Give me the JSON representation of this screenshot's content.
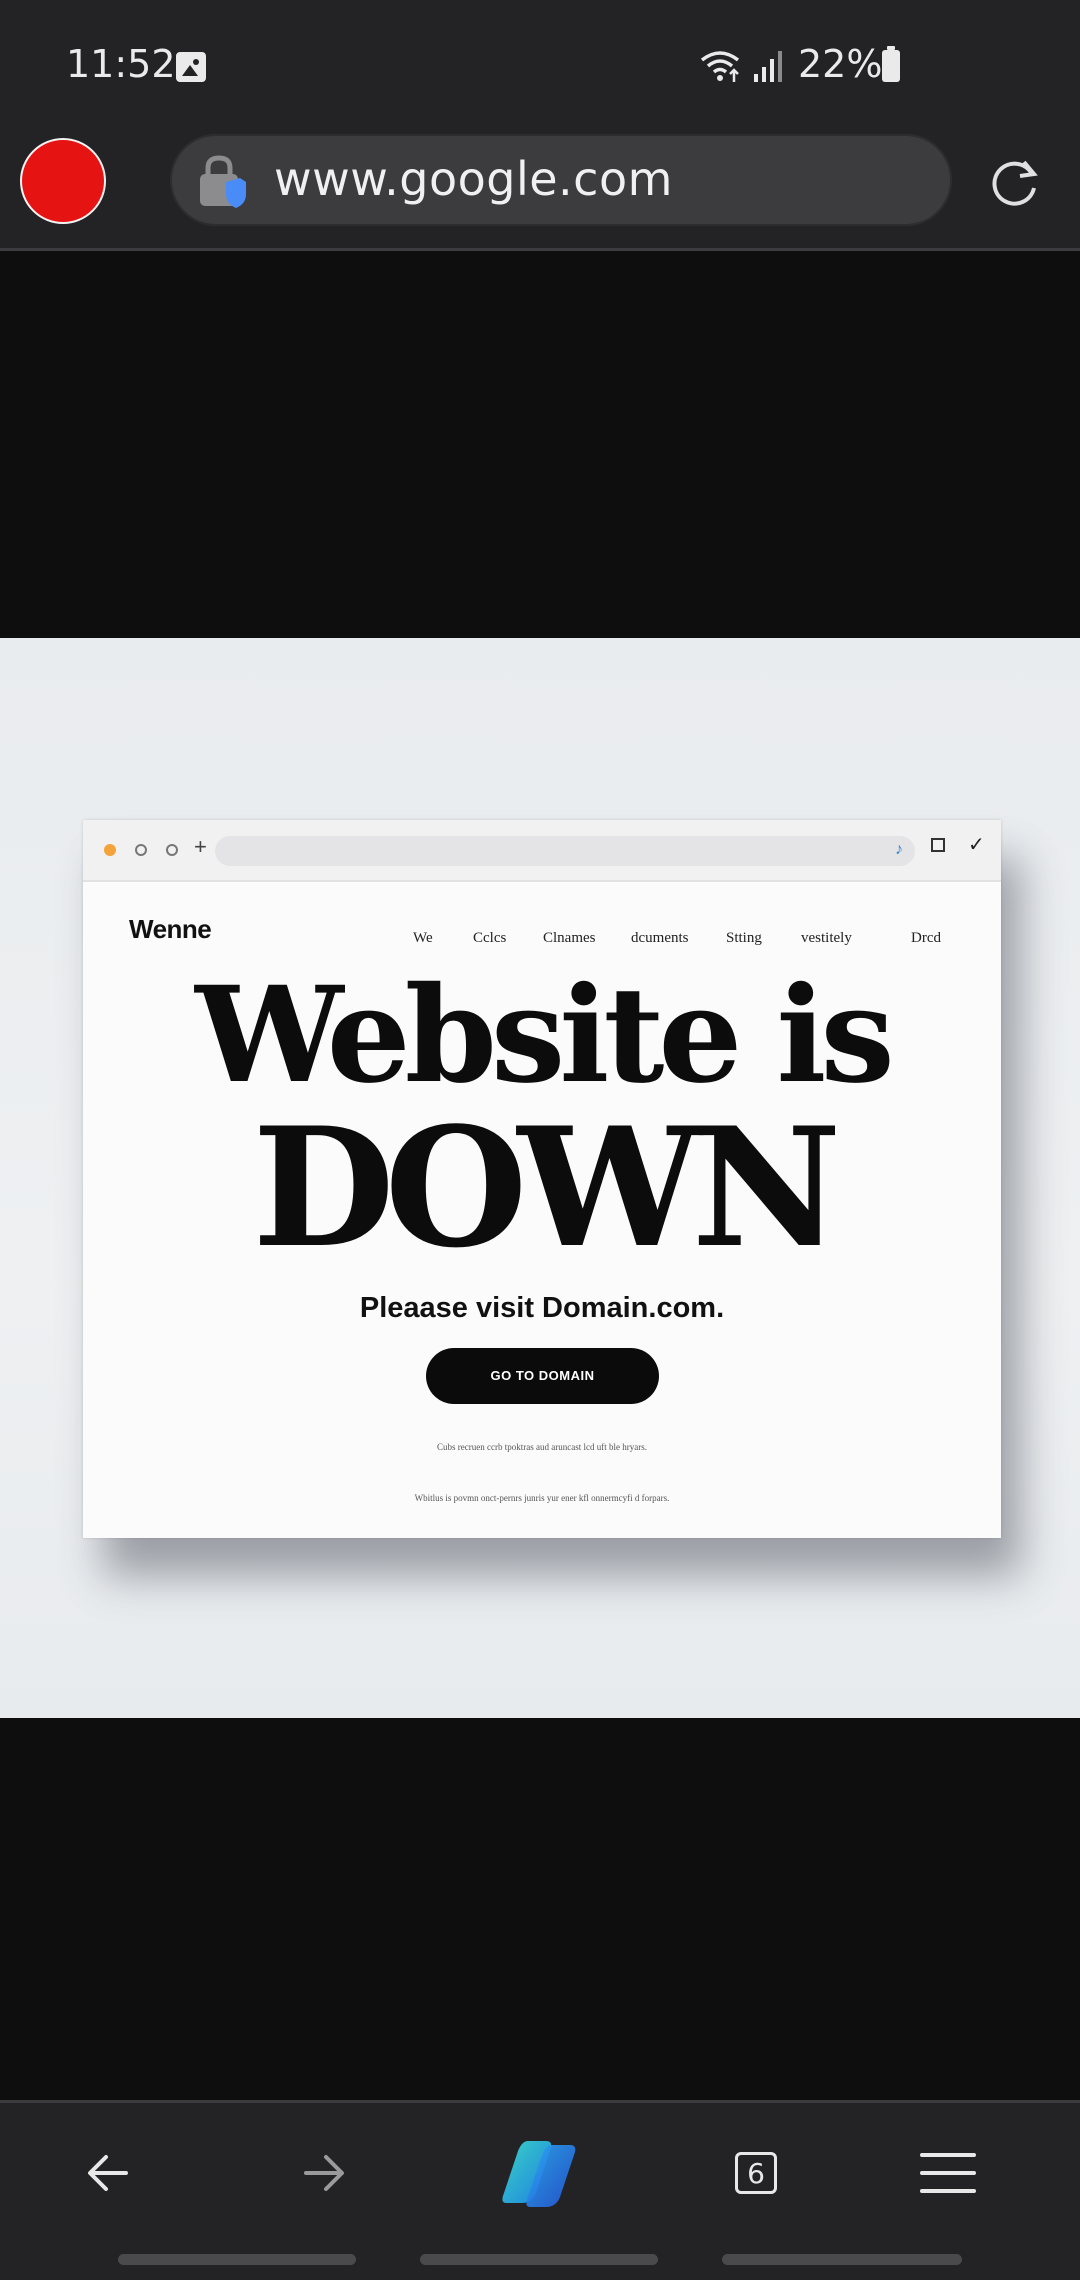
{
  "status_bar": {
    "time": "11:52",
    "battery": "22%",
    "icons": [
      "gallery-icon",
      "wifi-icon",
      "signal-icon",
      "battery-icon"
    ]
  },
  "toolbar": {
    "url": "www.google.com",
    "avatar_color": "#e61313",
    "icons": [
      "lock-icon",
      "reload-icon"
    ]
  },
  "mock_site": {
    "logo": "Wenne",
    "nav": [
      "We",
      "Cclcs",
      "Clnames",
      "dcuments",
      "Stting",
      "vestitely",
      "Drcd"
    ],
    "headline_line1": "Website is",
    "headline_line2": "DOWN",
    "visit_text": "Pleaase visit Domain.com.",
    "cta_label": "GO TO DOMAIN",
    "small_line1": "Cubs recruen ccrb tpoktras aud aruncast lcd uft ble hryars.",
    "small_line2": "Wbitlus is povmn onct-pernrs junris yur ener kfl onnermcyfi d forpars."
  },
  "bottom_bar": {
    "tab_count": "6",
    "icons": [
      "back-arrow-icon",
      "forward-arrow-icon",
      "copilot-icon",
      "tabs-icon",
      "menu-icon"
    ]
  }
}
